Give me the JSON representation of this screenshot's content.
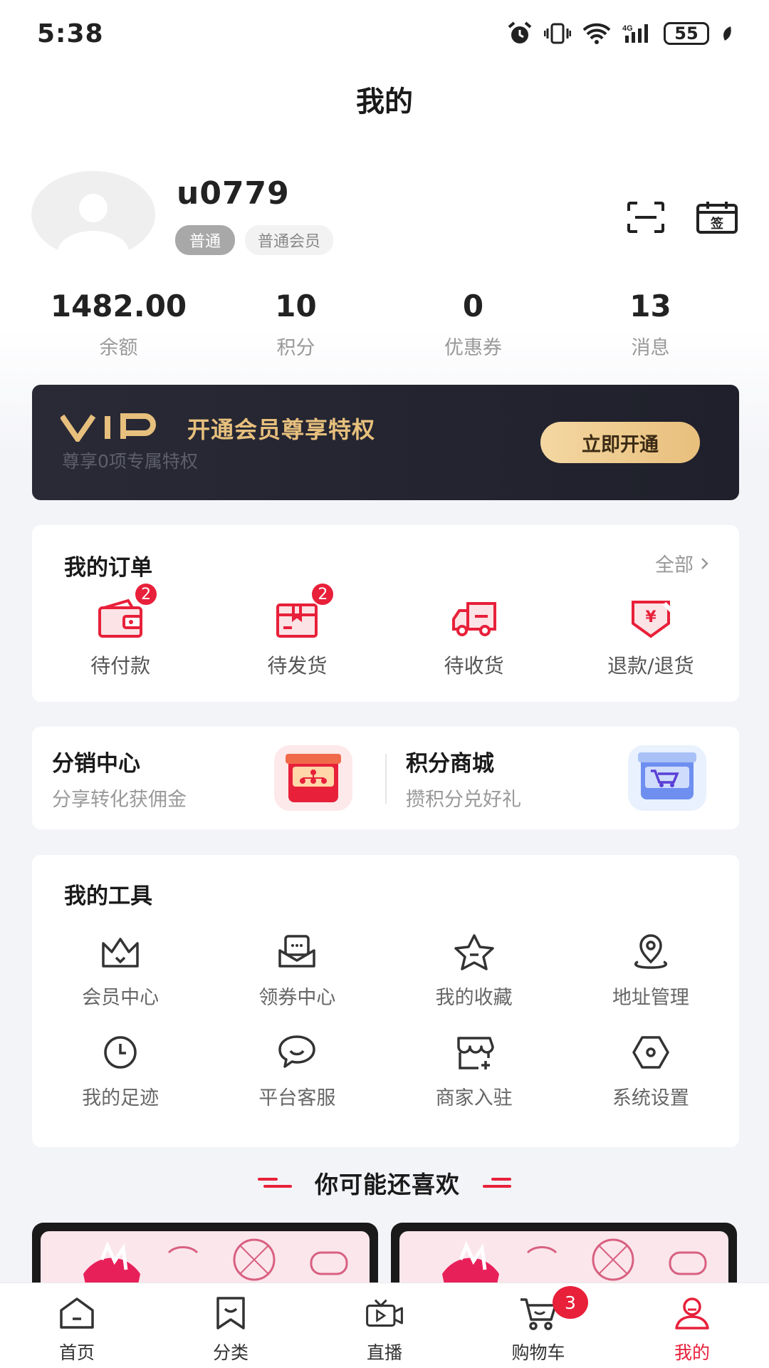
{
  "status_bar": {
    "time": "5:38",
    "network": "4G",
    "battery": "55"
  },
  "header": {
    "title": "我的"
  },
  "profile": {
    "username": "u0779",
    "level_tag": "普通",
    "member_tag": "普通会员"
  },
  "stats": [
    {
      "value": "1482.00",
      "label": "余额"
    },
    {
      "value": "10",
      "label": "积分"
    },
    {
      "value": "0",
      "label": "优惠券"
    },
    {
      "value": "13",
      "label": "消息"
    }
  ],
  "vip": {
    "title": "开通会员尊享特权",
    "subtitle": "尊享0项专属特权",
    "button": "立即开通"
  },
  "orders": {
    "title": "我的订单",
    "view_all": "全部",
    "items": [
      {
        "label": "待付款",
        "badge": "2",
        "icon": "wallet-icon"
      },
      {
        "label": "待发货",
        "badge": "2",
        "icon": "box-icon"
      },
      {
        "label": "待收货",
        "icon": "truck-icon"
      },
      {
        "label": "退款/退货",
        "icon": "refund-icon"
      }
    ]
  },
  "promo": {
    "distribution": {
      "title": "分销中心",
      "subtitle": "分享转化获佣金"
    },
    "points_mall": {
      "title": "积分商城",
      "subtitle": "攒积分兑好礼"
    }
  },
  "tools": {
    "title": "我的工具",
    "items": [
      {
        "label": "会员中心",
        "icon": "crown-icon"
      },
      {
        "label": "领券中心",
        "icon": "coupon-icon"
      },
      {
        "label": "我的收藏",
        "icon": "star-icon"
      },
      {
        "label": "地址管理",
        "icon": "location-icon"
      },
      {
        "label": "我的足迹",
        "icon": "clock-icon"
      },
      {
        "label": "平台客服",
        "icon": "chat-icon"
      },
      {
        "label": "商家入驻",
        "icon": "store-icon"
      },
      {
        "label": "系统设置",
        "icon": "settings-icon"
      }
    ]
  },
  "recommend": {
    "title": "你可能还喜欢"
  },
  "tabbar": [
    {
      "label": "首页",
      "icon": "home-icon"
    },
    {
      "label": "分类",
      "icon": "category-icon"
    },
    {
      "label": "直播",
      "icon": "live-icon"
    },
    {
      "label": "购物车",
      "icon": "cart-icon",
      "badge": "3"
    },
    {
      "label": "我的",
      "icon": "user-icon",
      "active": true
    }
  ],
  "colors": {
    "accent": "#e8203a",
    "vip_gold": "#e7c07d",
    "vip_bg": "#23242f"
  }
}
